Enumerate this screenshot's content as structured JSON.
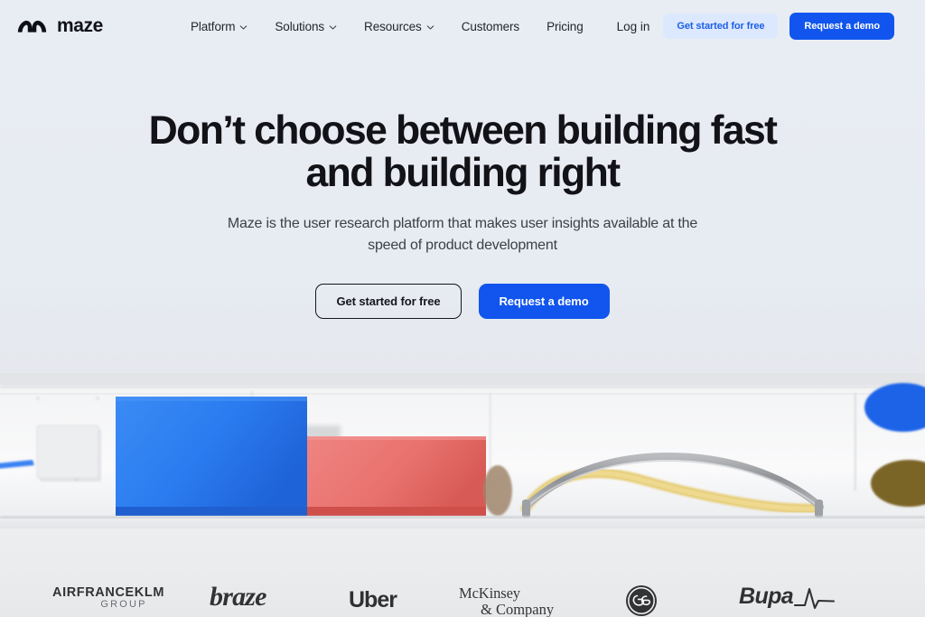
{
  "nav": {
    "brand": {
      "name": "maze",
      "logo_icon": "maze-arch-logo"
    },
    "links": [
      {
        "label": "Platform",
        "has_dropdown": true
      },
      {
        "label": "Solutions",
        "has_dropdown": true
      },
      {
        "label": "Resources",
        "has_dropdown": true
      },
      {
        "label": "Customers",
        "has_dropdown": false
      },
      {
        "label": "Pricing",
        "has_dropdown": false
      }
    ],
    "login_label": "Log in",
    "get_started_label": "Get started for free",
    "request_demo_label": "Request a demo"
  },
  "hero": {
    "headline_line1": "Don’t choose between building fast",
    "headline_line2": "and building right",
    "subhead_line1": "Maze is the user research platform that makes user insights available at the",
    "subhead_line2": "speed of product development",
    "cta_primary": "Get started for free",
    "cta_secondary": "Request a demo"
  },
  "logos": [
    {
      "name": "AIRFRANCEKLM",
      "sub": "GROUP"
    },
    {
      "name": "braze"
    },
    {
      "name": "Uber"
    },
    {
      "name": "McKinsey",
      "sub": "& Company"
    },
    {
      "name": "GE"
    },
    {
      "name": "Bupa"
    }
  ],
  "colors": {
    "brand_blue": "#1155ee",
    "soft_blue_bg": "#dce8fe",
    "soft_blue_text": "#1b5fe8",
    "text_dark": "#121217",
    "page_bg_top": "#e8ecf3",
    "page_bg_bottom": "#e2e4e7",
    "photo_block_blue": "#2d7ef0",
    "photo_block_red": "#e8716d"
  }
}
